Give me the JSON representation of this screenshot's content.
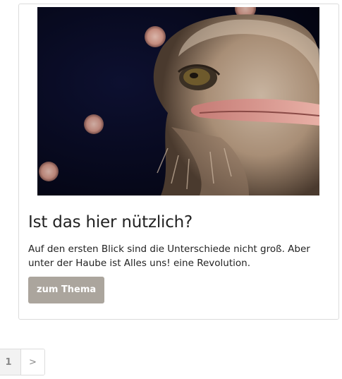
{
  "article": {
    "title": "Ist das hier nützlich?",
    "text": "Auf den ersten Blick sind die Unterschiede nicht groß. Aber unter der Haube ist Alles uns! eine Revolution.",
    "button_label": "zum Thema",
    "image_subject": "ostrich-head-photo"
  },
  "pagination": {
    "current_page": "1",
    "next_label": ">"
  },
  "colors": {
    "button_bg": "#aba59d",
    "card_border": "#dcdcdc",
    "image_background": "#060818"
  }
}
